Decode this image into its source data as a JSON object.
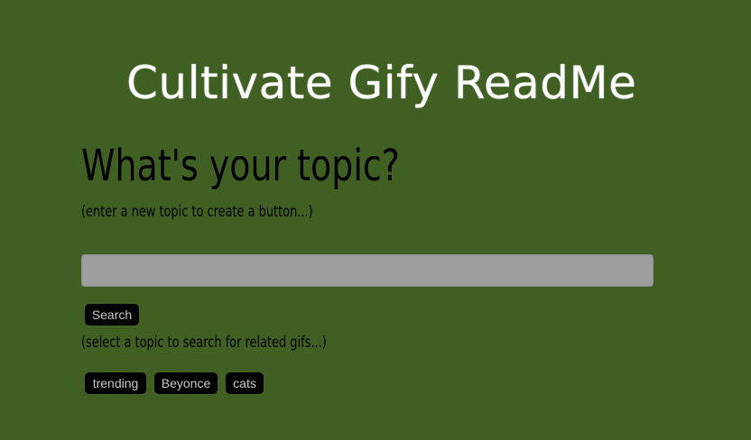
{
  "header": {
    "title": "Cultivate Gify ReadMe"
  },
  "form": {
    "heading": "What's your topic?",
    "instruction": "(enter a new topic to create a button...)",
    "input_value": "",
    "search_label": "Search"
  },
  "topics": {
    "instruction": "(select a topic to search for related gifs...)",
    "buttons": [
      "trending",
      "Beyonce",
      "cats"
    ]
  },
  "colors": {
    "background": "#3f6022",
    "input": "#9e9e9e",
    "button": "#000000",
    "button_text": "#c8c8c8",
    "title": "#ffffff"
  }
}
